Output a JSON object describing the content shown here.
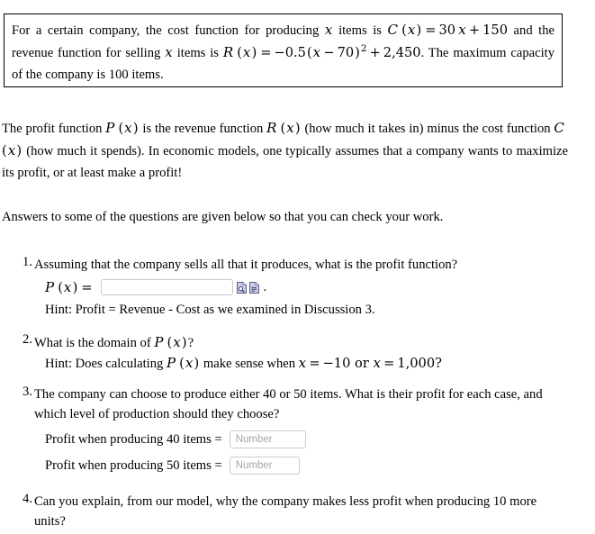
{
  "problem_box": {
    "text_segments": [
      "For a certain company, the cost function for producing ",
      " items is ",
      " and the revenue function for selling ",
      " items is ",
      ". The maximum capacity of the company is 100 items."
    ],
    "var_x": "x",
    "cost_function": "C (x) = 30 x + 150",
    "revenue_function": "R (x) = −0.5(x − 70)2 + 2,450",
    "cost_fn_name": "C",
    "revenue_fn_name": "R",
    "cost_slope": "30",
    "cost_intercept": "150",
    "revenue_coefficient": "−0.5",
    "revenue_shift": "70",
    "revenue_exponent": "2",
    "revenue_constant": "2,450",
    "max_capacity_sentence": ". The maximum capacity of the company is 100 items.",
    "max_capacity": "100"
  },
  "paragraphs": {
    "profit_intro_a": "The profit function ",
    "profit_intro_b": " is the revenue function ",
    "profit_intro_c": " (how much it takes in)  minus the cost function ",
    "profit_intro_d": " (how much it spends). In economic models, one typically assumes that a company wants to maximize its profit, or at least make a profit!",
    "answers_note": "Answers to some of the questions are given below so that you can check your work.",
    "profit_fn_name": "P",
    "revenue_fn_name": "R",
    "cost_fn_name": "C",
    "var_x": "x"
  },
  "questions": [
    {
      "number": "1.",
      "text": "Assuming that the company sells all that it produces, what is the profit function?",
      "answer_label_fn": "P",
      "answer_label_var": "x",
      "answer_label_equals": "=",
      "input_value": "",
      "input_placeholder": "",
      "icons": [
        "preview-document-icon",
        "preview-document-alt-icon"
      ],
      "trailing_punctuation": ".",
      "hint": "Hint: Profit = Revenue - Cost as we examined in Discussion 3."
    },
    {
      "number": "2.",
      "text_a": "What is the domain of ",
      "text_b": "?",
      "fn_name": "P",
      "var_x": "x",
      "hint_a": "Hint: Does calculating ",
      "hint_b": " make sense when ",
      "hint_c": " = −10 or ",
      "hint_d": " = 1,000?",
      "hint_value_1": "−10",
      "hint_value_2": "1,000"
    },
    {
      "number": "3.",
      "text": "The company can choose to produce either 40 or 50 items. What is their profit for each case, and which level of production should they choose?",
      "answers": [
        {
          "label": "Profit when producing 40 items =",
          "value": "",
          "placeholder": "Number"
        },
        {
          "label": "Profit when producing 50 items =",
          "value": "",
          "placeholder": "Number"
        }
      ]
    },
    {
      "number": "4.",
      "text": "Can you explain, from our model, why the company makes less profit when producing 10 more units?"
    }
  ],
  "colors": {
    "text": "#000000",
    "box_border": "#000000",
    "input_border": "#cccccc",
    "placeholder": "#a6a6a6",
    "icon_fill": "#c8cce8",
    "icon_stroke": "#5b5f8c"
  }
}
